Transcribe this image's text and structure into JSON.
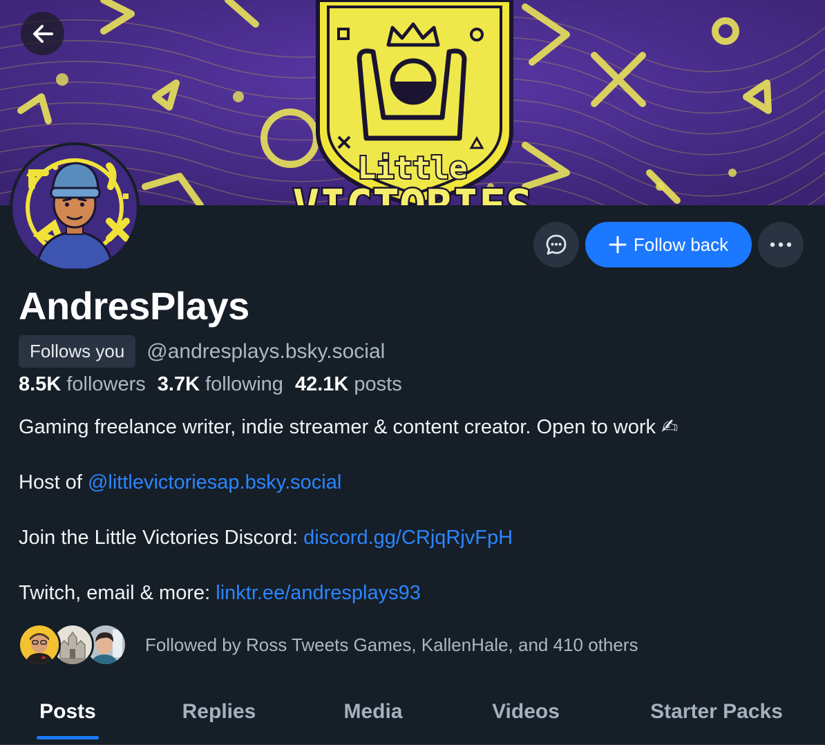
{
  "banner": {
    "logo_text_top": "Little",
    "logo_text_bottom": "VICTORIES"
  },
  "actions": {
    "follow_back_label": "Follow back"
  },
  "profile": {
    "display_name": "AndresPlays",
    "follows_you_badge": "Follows you",
    "handle": "@andresplays.bsky.social",
    "stats": {
      "followers_count": "8.5K",
      "followers_label": "followers",
      "following_count": "3.7K",
      "following_label": "following",
      "posts_count": "42.1K",
      "posts_label": "posts"
    },
    "bio": {
      "line1": "Gaming freelance writer, indie streamer & content creator. Open to work ✍",
      "line2_prefix": "Host of ",
      "line2_link": "@littlevictoriesap.bsky.social",
      "line3_prefix": "Join the Little Victories Discord: ",
      "line3_link": "discord.gg/CRjqRjvFpH",
      "line4_prefix": "Twitch, email & more: ",
      "line4_link": "linktr.ee/andresplays93"
    },
    "followed_by": "Followed by Ross Tweets Games, KallenHale, and 410 others"
  },
  "tabs": [
    {
      "label": "Posts",
      "active": true
    },
    {
      "label": "Replies",
      "active": false
    },
    {
      "label": "Media",
      "active": false
    },
    {
      "label": "Videos",
      "active": false
    },
    {
      "label": "Starter Packs",
      "active": false
    }
  ],
  "colors": {
    "background": "#161e27",
    "accent": "#1c79ff",
    "link": "#2b86ff",
    "banner_purple": "#4b2d8c",
    "banner_yellow": "#e9e25a"
  }
}
